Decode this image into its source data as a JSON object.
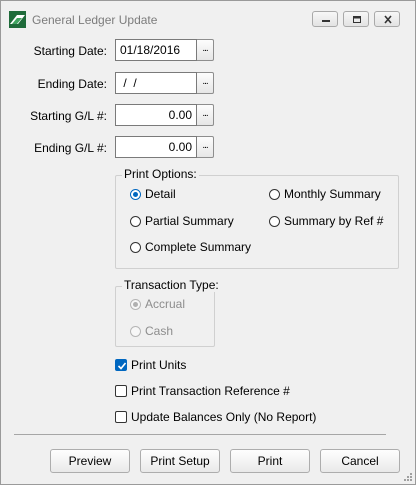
{
  "window": {
    "title": "General Ledger Update"
  },
  "fields": {
    "starting_date": {
      "label": "Starting Date:",
      "value": "01/18/2016"
    },
    "ending_date": {
      "label": "Ending Date:",
      "value": " /  /"
    },
    "starting_gl": {
      "label": "Starting G/L #:",
      "value": "0.00"
    },
    "ending_gl": {
      "label": "Ending G/L #:",
      "value": "0.00"
    },
    "lookup_label": "..."
  },
  "print_options": {
    "title": "Print Options:",
    "detail": "Detail",
    "partial_summary": "Partial Summary",
    "complete_summary": "Complete Summary",
    "monthly_summary": "Monthly Summary",
    "summary_by_ref": "Summary by Ref #",
    "selected": "Detail"
  },
  "transaction_type": {
    "title": "Transaction Type:",
    "accrual": "Accrual",
    "cash": "Cash",
    "selected": "Accrual"
  },
  "checkboxes": {
    "print_units": {
      "label": "Print Units",
      "checked": true
    },
    "print_txn_ref": {
      "label": "Print Transaction Reference #",
      "checked": false
    },
    "update_balances_only": {
      "label": "Update Balances Only (No Report)",
      "checked": false
    }
  },
  "buttons": {
    "preview": "Preview",
    "print_setup": "Print Setup",
    "print": "Print",
    "cancel": "Cancel"
  },
  "icons": {
    "app": "app-logo-icon",
    "minimize": "minimize-icon",
    "maximize": "maximize-icon",
    "close": "close-icon",
    "checkmark": "checkmark-icon",
    "resize": "resize-grip-icon"
  },
  "colors": {
    "accent": "#0067c0",
    "window_bg": "#f0f0f0",
    "title_text": "#7c7c7c"
  }
}
